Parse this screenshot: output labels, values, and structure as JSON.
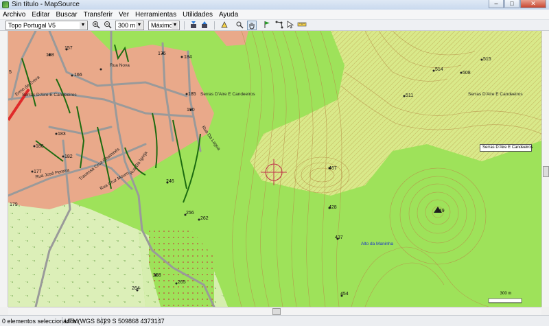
{
  "window": {
    "title": "Sin título - MapSource",
    "buttons": {
      "minimize": "–",
      "maximize": "□",
      "close": "✕"
    }
  },
  "menu": [
    "Archivo",
    "Editar",
    "Buscar",
    "Transferir",
    "Ver",
    "Herramientas",
    "Utilidades",
    "Ayuda"
  ],
  "toolbar": {
    "product": "Topo Portugal V5",
    "scale": "300 m",
    "detail": "Máximo"
  },
  "map": {
    "poi_labels": [
      {
        "text": "157"
      },
      {
        "text": "158"
      },
      {
        "text": "166"
      },
      {
        "text": "175"
      },
      {
        "text": "184"
      },
      {
        "text": "185"
      },
      {
        "text": "190"
      },
      {
        "text": "183"
      },
      {
        "text": "186"
      },
      {
        "text": "182"
      },
      {
        "text": "177"
      },
      {
        "text": "179"
      },
      {
        "text": "246"
      },
      {
        "text": "256"
      },
      {
        "text": "262"
      },
      {
        "text": "258"
      },
      {
        "text": "265"
      },
      {
        "text": "264"
      },
      {
        "text": "428"
      },
      {
        "text": "437"
      },
      {
        "text": "454"
      },
      {
        "text": "467"
      },
      {
        "text": "511"
      },
      {
        "text": "514"
      },
      {
        "text": "508"
      },
      {
        "text": "515"
      },
      {
        "text": "549"
      },
      {
        "text": "5"
      },
      {
        "text": "2"
      }
    ],
    "road_labels": {
      "rua_nova": "Rua Nova",
      "ermo_de_evora": "Ermo de Évora",
      "serras_left": "Serras D'Aire E Candeeiros",
      "serras_mid": "Serras D'Aire E Candeeiros",
      "serras_right": "Serras D'Aire E Candeeiros",
      "cruz_chamines": "Travessa Cruz Chaminés",
      "cruz_mouro": "Rua Cruz Mouro",
      "da_igreja": "Rua Da Igreja",
      "da_lagoa": "Rua Da Lagoa",
      "jose_pereira": "Rua José Pereira",
      "alto_maninha": "Alto da Maninha"
    },
    "info_box": "Serras D'Aire E Candeeiros",
    "scale_bar": "300 m"
  },
  "statusbar": {
    "selection": "0 elementos seleccionados",
    "datum": "UTM(WGS 84)",
    "coords": "29 S 509868 4373147"
  },
  "colors": {
    "forest": "#9ee25a",
    "urban": "#e9a98a",
    "yellow_area": "#d8e88a",
    "contour": "#b7914a",
    "road": "#9a9a9a",
    "track": "#1c6b10",
    "cursor": "#c0304a"
  },
  "icons": {
    "zoom_in": "zoom-in-icon",
    "zoom_out": "zoom-out-icon",
    "hand": "hand-tool-icon",
    "flag": "waypoint-flag-icon"
  }
}
